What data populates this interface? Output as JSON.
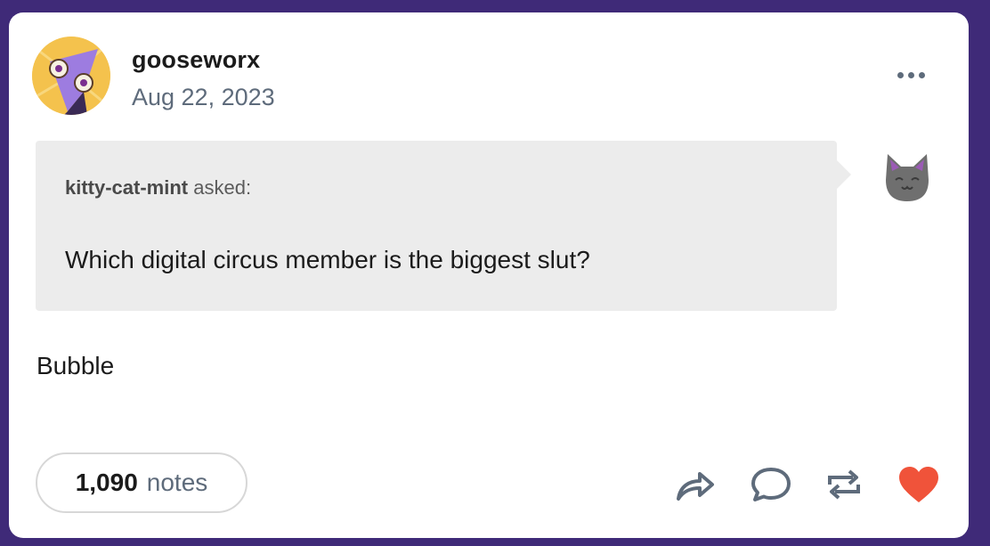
{
  "post": {
    "author": "gooseworx",
    "date": "Aug 22, 2023",
    "ask": {
      "asker": "kitty-cat-mint",
      "asked_label": "asked:",
      "question": "Which digital circus member is the biggest slut?"
    },
    "answer": "Bubble"
  },
  "footer": {
    "notes_count": "1,090",
    "notes_label": "notes",
    "actions": [
      "share-icon",
      "reply-icon",
      "reblog-icon",
      "like-heart-icon"
    ]
  },
  "colors": {
    "background": "#3f2a78",
    "card": "#ffffff",
    "ask_box": "#ececec",
    "muted_text": "#5e6b7b",
    "heart": "#f0533a",
    "icon": "#5e6b7b"
  }
}
